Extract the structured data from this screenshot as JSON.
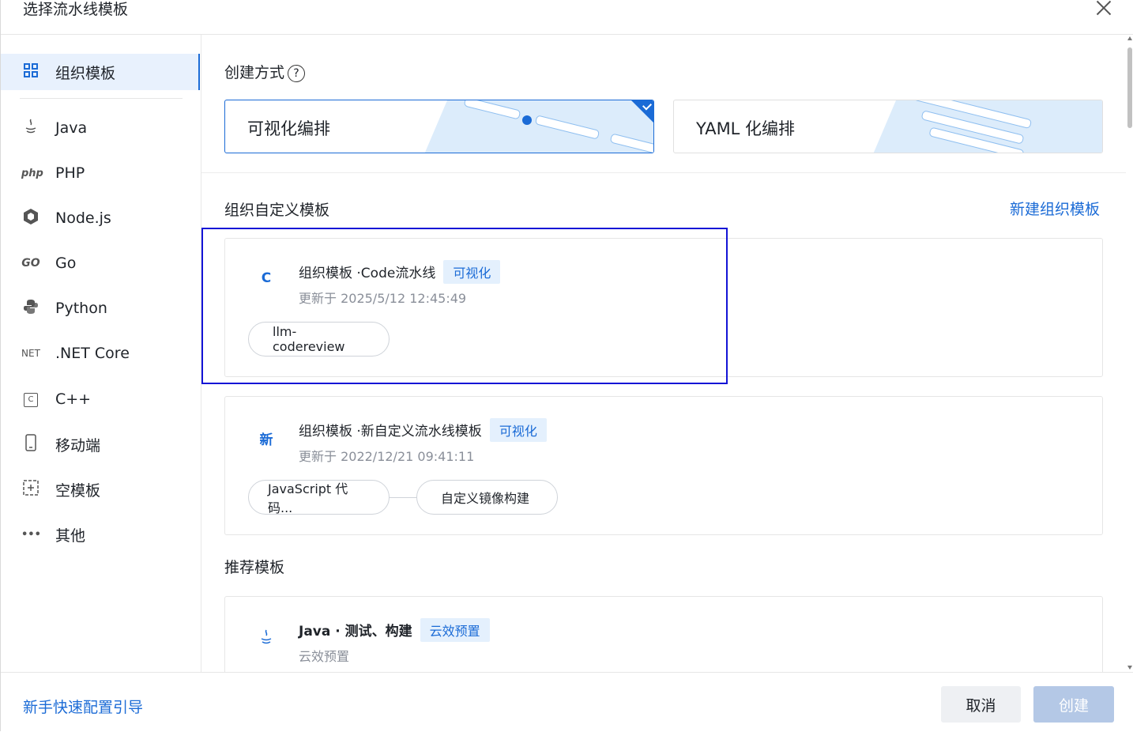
{
  "dialog": {
    "title": "选择流水线模板"
  },
  "sidebar": {
    "items": [
      {
        "label": "组织模板",
        "icon": "grid-icon"
      },
      {
        "label": "Java",
        "icon": "java-icon"
      },
      {
        "label": "PHP",
        "icon": "php-icon",
        "icon_text": "php"
      },
      {
        "label": "Node.js",
        "icon": "nodejs-icon"
      },
      {
        "label": "Go",
        "icon": "go-icon",
        "icon_text": "GO"
      },
      {
        "label": "Python",
        "icon": "python-icon"
      },
      {
        "label": ".NET Core",
        "icon": "dotnet-icon",
        "icon_text": "NET"
      },
      {
        "label": "C++",
        "icon": "cpp-icon",
        "icon_text": "C"
      },
      {
        "label": "移动端",
        "icon": "mobile-icon"
      },
      {
        "label": "空模板",
        "icon": "empty-template-icon"
      },
      {
        "label": "其他",
        "icon": "more-icon",
        "icon_text": "•••"
      }
    ]
  },
  "create_mode": {
    "label": "创建方式",
    "help": "?",
    "options": [
      {
        "label": "可视化编排",
        "selected": true
      },
      {
        "label": "YAML 化编排",
        "selected": false
      }
    ]
  },
  "org_templates": {
    "heading": "组织自定义模板",
    "new_link": "新建组织模板",
    "cards": [
      {
        "avatar": "C",
        "name": "组织模板 ·Code流水线",
        "badge": "可视化",
        "updated": "更新于 2025/5/12 12:45:49",
        "steps": [
          "llm-codereview"
        ]
      },
      {
        "avatar": "新",
        "name": "组织模板 ·新自定义流水线模板",
        "badge": "可视化",
        "updated": "更新于 2022/12/21 09:41:11",
        "steps": [
          "JavaScript 代码...",
          "自定义镜像构建"
        ]
      }
    ]
  },
  "recommended": {
    "heading": "推荐模板",
    "cards": [
      {
        "name": "Java · 测试、构建",
        "badge": "云效预置",
        "updated": "云效预置"
      }
    ]
  },
  "footer": {
    "guide": "新手快速配置引导",
    "cancel": "取消",
    "create": "创建"
  },
  "colors": {
    "accent": "#1b6bd6",
    "highlight": "#1414d6",
    "badge_bg": "#e4f0fd",
    "create_disabled": "#b4c8e6"
  }
}
